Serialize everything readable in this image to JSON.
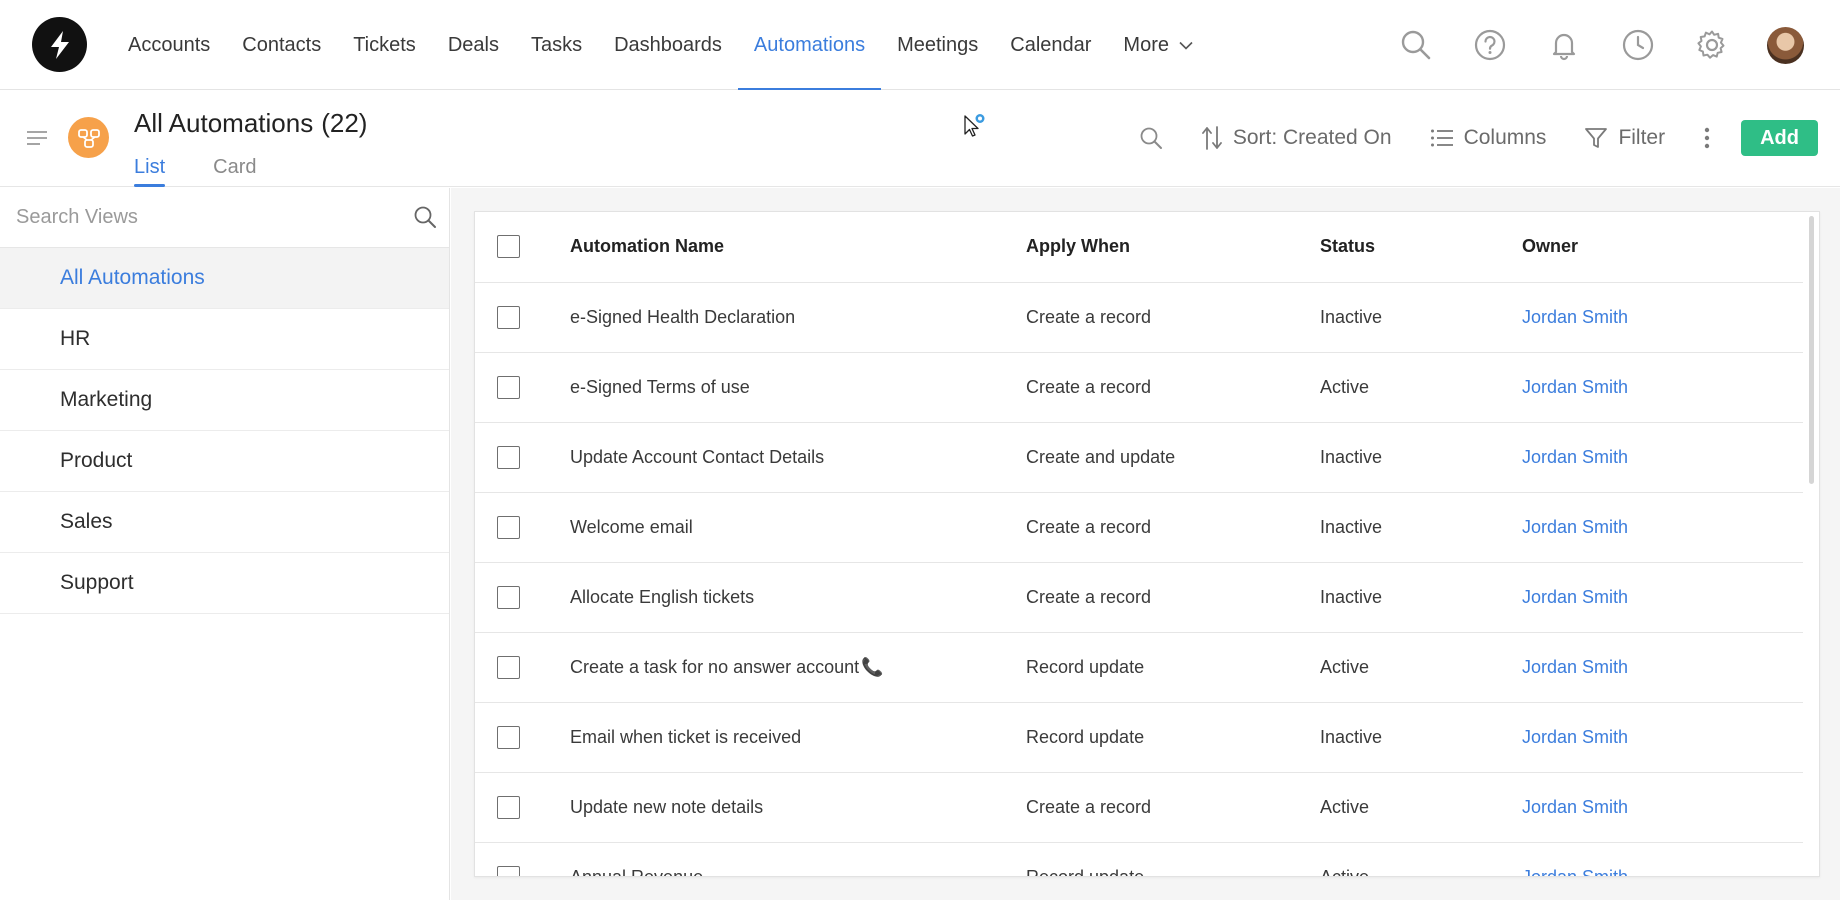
{
  "nav": {
    "items": [
      {
        "label": "Accounts",
        "active": false
      },
      {
        "label": "Contacts",
        "active": false
      },
      {
        "label": "Tickets",
        "active": false
      },
      {
        "label": "Deals",
        "active": false
      },
      {
        "label": "Tasks",
        "active": false
      },
      {
        "label": "Dashboards",
        "active": false
      },
      {
        "label": "Automations",
        "active": true
      },
      {
        "label": "Meetings",
        "active": false
      },
      {
        "label": "Calendar",
        "active": false
      }
    ],
    "more_label": "More",
    "icons": [
      "search-icon",
      "help-icon",
      "bell-icon",
      "clock-icon",
      "gear-icon"
    ]
  },
  "header": {
    "title": "All Automations",
    "count": "(22)",
    "tabs": [
      "List",
      "Card"
    ],
    "active_tab": "List"
  },
  "toolbar": {
    "sort_label": "Sort: Created On",
    "columns_label": "Columns",
    "filter_label": "Filter",
    "add_label": "Add"
  },
  "sidebar": {
    "search_placeholder": "Search Views",
    "views": [
      "All Automations",
      "HR",
      "Marketing",
      "Product",
      "Sales",
      "Support"
    ],
    "active_view": "All Automations"
  },
  "table": {
    "columns": [
      "Automation Name",
      "Apply When",
      "Status",
      "Owner"
    ],
    "rows": [
      {
        "name": "e-Signed Health Declaration",
        "apply": "Create a record",
        "status": "Inactive",
        "owner": "Jordan Smith"
      },
      {
        "name": "e-Signed Terms of use",
        "apply": "Create a record",
        "status": "Active",
        "owner": "Jordan Smith"
      },
      {
        "name": "Update Account Contact Details",
        "apply": "Create and update",
        "status": "Inactive",
        "owner": "Jordan Smith"
      },
      {
        "name": "Welcome email",
        "apply": "Create a record",
        "status": "Inactive",
        "owner": "Jordan Smith"
      },
      {
        "name": "Allocate English tickets",
        "apply": "Create a record",
        "status": "Inactive",
        "owner": "Jordan Smith"
      },
      {
        "name": "Create a task for no answer account",
        "emoji": "📞",
        "apply": "Record update",
        "status": "Active",
        "owner": "Jordan Smith"
      },
      {
        "name": "Email when ticket is received",
        "apply": "Record update",
        "status": "Inactive",
        "owner": "Jordan Smith"
      },
      {
        "name": "Update new note details",
        "apply": "Create a record",
        "status": "Active",
        "owner": "Jordan Smith"
      },
      {
        "name": "Annual Revenue",
        "apply": "Record update",
        "status": "Active",
        "owner": "Jordan Smith"
      }
    ]
  },
  "colors": {
    "accent": "#3b7ddd",
    "add_button": "#2fbe86",
    "module_icon": "#f6a14a"
  }
}
